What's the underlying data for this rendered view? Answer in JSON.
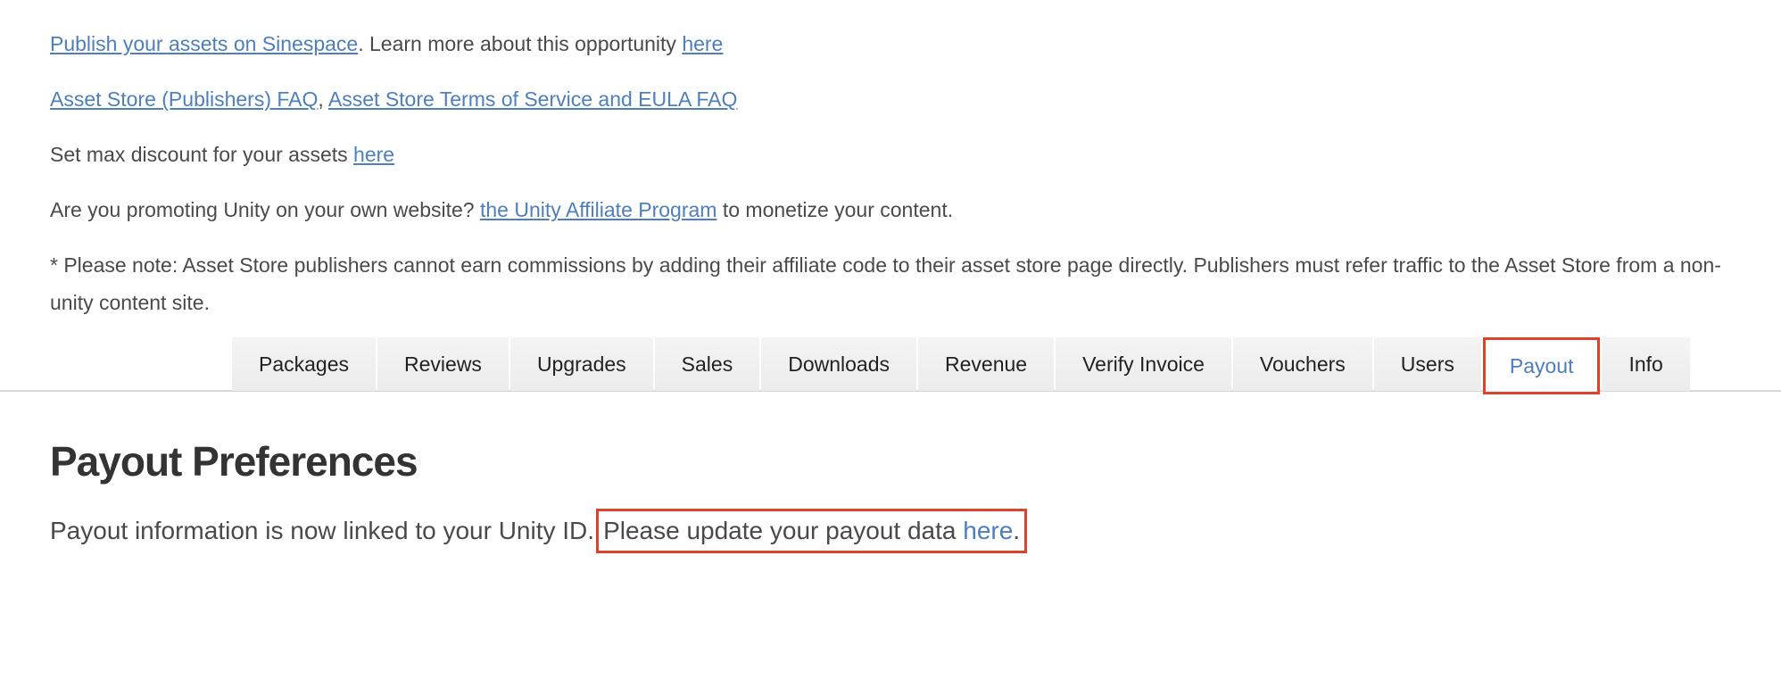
{
  "intro": {
    "publish_link": "Publish your assets on Sinespace",
    "publish_text": ". Learn more about this opportunity ",
    "publish_here": "here",
    "faq_link": "Asset Store (Publishers) FAQ",
    "faq_sep": ", ",
    "tos_link": "Asset Store Terms of Service and EULA FAQ",
    "discount_text": "Set max discount for your assets ",
    "discount_here": "here",
    "promo_text": "Are you promoting Unity on your own website? ",
    "affiliate_link": "the Unity Affiliate Program",
    "promo_tail": " to monetize your content.",
    "note": "* Please note: Asset Store publishers cannot earn commissions by adding their affiliate code to their asset store page directly. Publishers must refer traffic to the Asset Store from a non-unity content site."
  },
  "tabs": [
    {
      "label": "Packages"
    },
    {
      "label": "Reviews"
    },
    {
      "label": "Upgrades"
    },
    {
      "label": "Sales"
    },
    {
      "label": "Downloads"
    },
    {
      "label": "Revenue"
    },
    {
      "label": "Verify Invoice"
    },
    {
      "label": "Vouchers"
    },
    {
      "label": "Users"
    },
    {
      "label": "Payout"
    },
    {
      "label": "Info"
    }
  ],
  "payout": {
    "title": "Payout Preferences",
    "info_text": "Payout information is now linked to your Unity ID.",
    "update_text": "Please update your payout data ",
    "update_link": "here",
    "update_tail": "."
  },
  "colors": {
    "link": "#4d7fbd",
    "highlight": "#e0412b",
    "text": "#4a4a4a"
  }
}
